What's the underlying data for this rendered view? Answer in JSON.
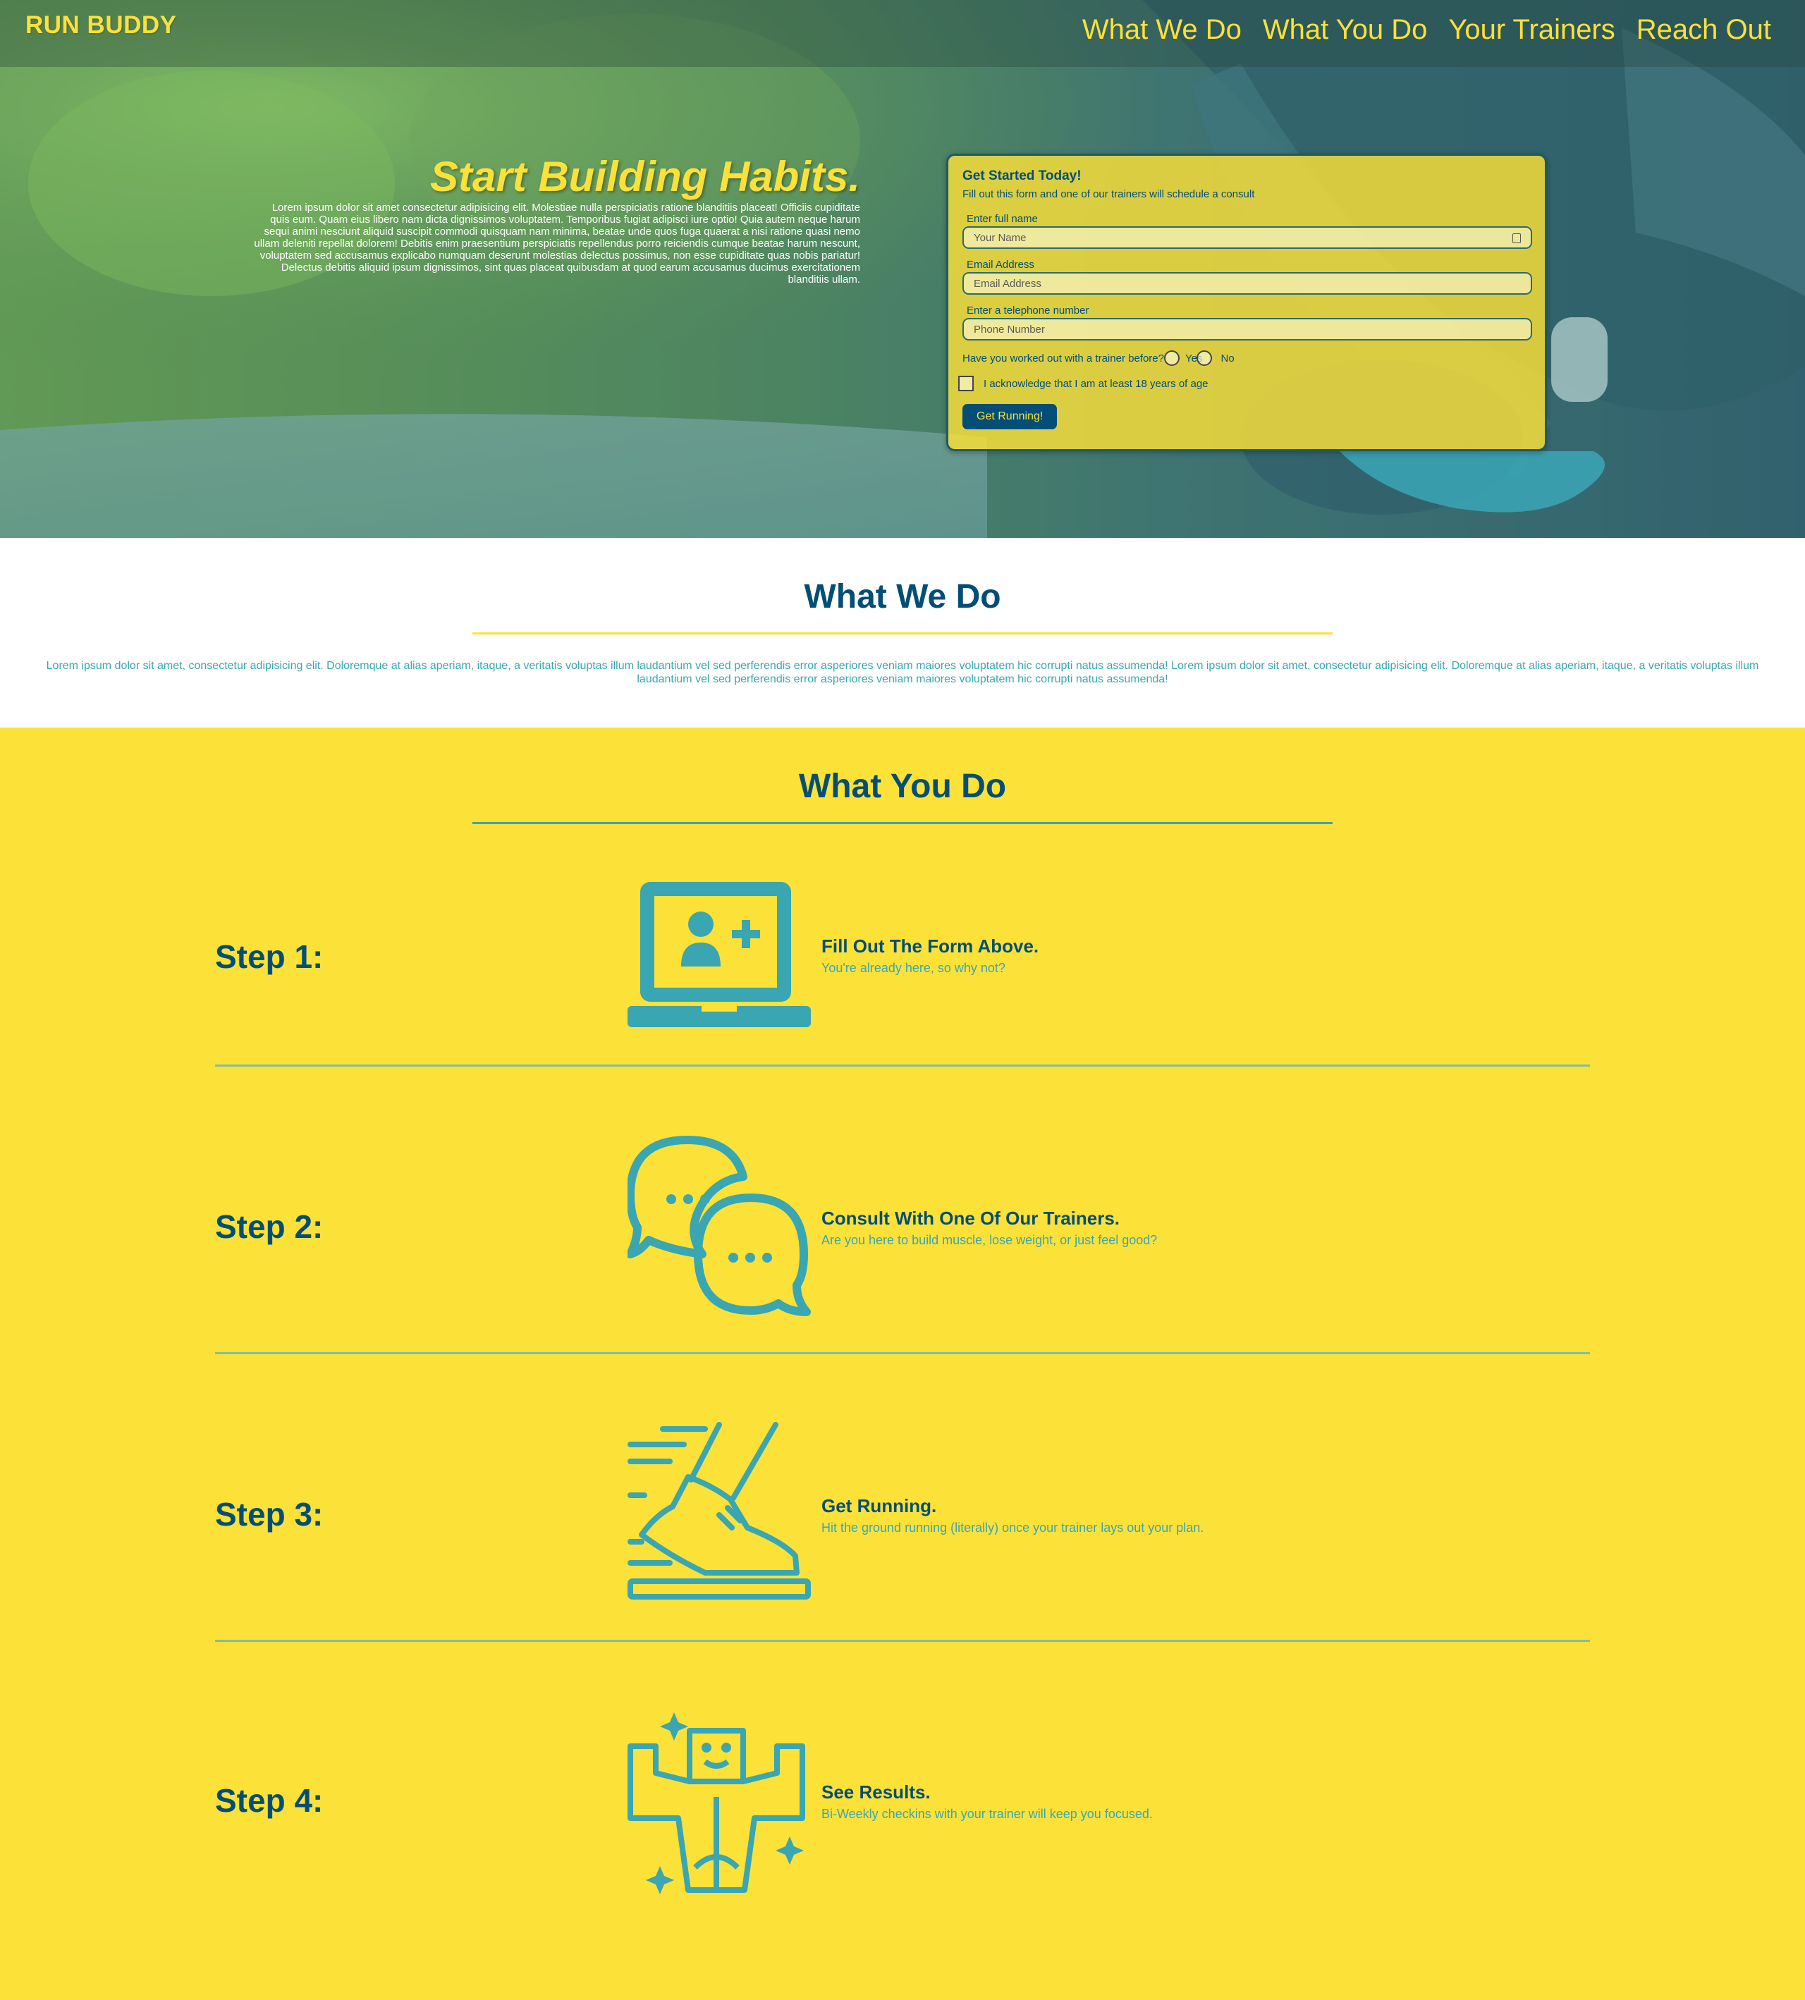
{
  "header": {
    "brand": "RUN BUDDY",
    "nav": [
      "What We Do",
      "What You Do",
      "Your Trainers",
      "Reach Out"
    ]
  },
  "hero": {
    "title": "Start Building Habits.",
    "text": "Lorem ipsum dolor sit amet consectetur adipisicing elit. Molestiae nulla perspiciatis ratione blanditiis placeat! Officiis cupiditate quis eum. Quam eius libero nam dicta dignissimos voluptatem. Temporibus fugiat adipisci iure optio! Quia autem neque harum sequi animi nesciunt aliquid suscipit commodi quisquam nam minima, beatae unde quos fuga quaerat a nisi ratione quasi nemo ullam deleniti repellat dolorem! Debitis enim praesentium perspiciatis repellendus porro reiciendis cumque beatae harum nescunt, voluptatem sed accusamus explicabo numquam deserunt molestias delectus possimus, non esse cupiditate quas nobis pariatur! Delectus debitis aliquid ipsum dignissimos, sint quas placeat quibusdam at quod earum accusamus ducimus exercitationem blanditiis ullam."
  },
  "form": {
    "title": "Get Started Today!",
    "subtitle": "Fill out this form and one of our trainers will schedule a consult",
    "name_label": "Enter full name",
    "name_placeholder": "Your Name",
    "email_label": "Email Address",
    "email_placeholder": "Email Address",
    "phone_label": "Enter a telephone number",
    "phone_placeholder": "Phone Number",
    "trainer_question": "Have you worked out with a trainer before?",
    "yes_label": "Yes",
    "no_label": "No",
    "age_ack": "I acknowledge that I am at least 18 years of age",
    "submit_label": "Get Running!"
  },
  "what_we_do": {
    "title": "What We Do",
    "text": "Lorem ipsum dolor sit amet, consectetur adipisicing elit. Doloremque at alias aperiam, itaque, a veritatis voluptas illum laudantium vel sed perferendis error asperiores veniam maiores voluptatem hic corrupti natus assumenda! Lorem ipsum dolor sit amet, consectetur adipisicing elit. Doloremque at alias aperiam, itaque, a veritatis voluptas illum laudantium vel sed perferendis error asperiores veniam maiores voluptatem hic corrupti natus assumenda!"
  },
  "what_you_do": {
    "title": "What You Do",
    "steps": [
      {
        "label": "Step 1:",
        "heading": "Fill Out The Form Above.",
        "sub": "You're already here, so why not?",
        "icon": "laptop-add-user-icon"
      },
      {
        "label": "Step 2:",
        "heading": "Consult With One Of Our Trainers.",
        "sub": "Are you here to build muscle, lose weight, or just feel good?",
        "icon": "chat-bubbles-icon"
      },
      {
        "label": "Step 3:",
        "heading": "Get Running.",
        "sub": "Hit the ground running (literally) once your trainer lays out your plan.",
        "icon": "running-shoe-icon"
      },
      {
        "label": "Step 4:",
        "heading": "See Results.",
        "sub": "Bi-Weekly checkins with your trainer will keep you focused.",
        "icon": "strong-body-icon"
      }
    ]
  },
  "colors": {
    "yellow": "#fce138",
    "navy": "#024e76",
    "teal": "#39a6b2"
  }
}
